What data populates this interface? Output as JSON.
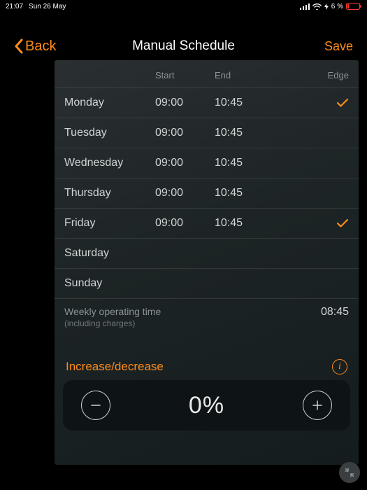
{
  "status": {
    "time": "21:07",
    "date": "Sun 26 May",
    "battery_pct": "6 %"
  },
  "nav": {
    "back_label": "Back",
    "title": "Manual Schedule",
    "save_label": "Save"
  },
  "table": {
    "headers": {
      "start": "Start",
      "end": "End",
      "edge": "Edge"
    },
    "rows": [
      {
        "day": "Monday",
        "start": "09:00",
        "end": "10:45",
        "edge": true
      },
      {
        "day": "Tuesday",
        "start": "09:00",
        "end": "10:45",
        "edge": false
      },
      {
        "day": "Wednesday",
        "start": "09:00",
        "end": "10:45",
        "edge": false
      },
      {
        "day": "Thursday",
        "start": "09:00",
        "end": "10:45",
        "edge": false
      },
      {
        "day": "Friday",
        "start": "09:00",
        "end": "10:45",
        "edge": true
      },
      {
        "day": "Saturday",
        "start": "",
        "end": "",
        "edge": false
      },
      {
        "day": "Sunday",
        "start": "",
        "end": "",
        "edge": false
      }
    ]
  },
  "summary": {
    "label": "Weekly operating time",
    "sublabel": "(including charges)",
    "value": "08:45"
  },
  "adjust": {
    "label": "Increase/decrease",
    "value": "0%",
    "info_glyph": "i"
  }
}
